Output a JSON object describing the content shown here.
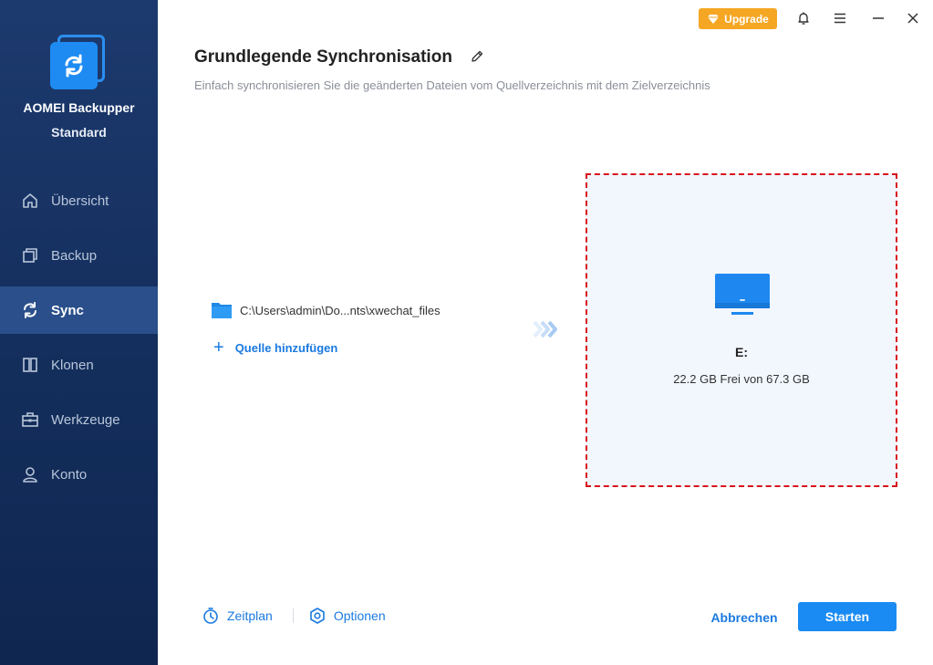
{
  "app": {
    "name": "AOMEI Backupper",
    "edition": "Standard",
    "logo_icon": "sync-logo-icon"
  },
  "sidebar": {
    "items": [
      {
        "label": "Übersicht",
        "icon": "home-icon",
        "active": false
      },
      {
        "label": "Backup",
        "icon": "backup-icon",
        "active": false
      },
      {
        "label": "Sync",
        "icon": "sync-icon",
        "active": true
      },
      {
        "label": "Klonen",
        "icon": "clone-icon",
        "active": false
      },
      {
        "label": "Werkzeuge",
        "icon": "toolbox-icon",
        "active": false
      },
      {
        "label": "Konto",
        "icon": "user-icon",
        "active": false
      }
    ]
  },
  "topbar": {
    "upgrade_label": "Upgrade",
    "icons": [
      "bell-icon",
      "menu-icon",
      "minimize-icon",
      "close-icon"
    ]
  },
  "header": {
    "title": "Grundlegende Synchronisation",
    "subtitle": "Einfach synchronisieren Sie die geänderten Dateien vom Quellverzeichnis mit dem Zielverzeichnis"
  },
  "source": {
    "path": "C:\\Users\\admin\\Do...nts\\xwechat_files",
    "add_label": "Quelle hinzufügen"
  },
  "destination": {
    "name": "E:",
    "free_space": "22.2 GB Frei von 67.3 GB"
  },
  "footer": {
    "schedule_label": "Zeitplan",
    "options_label": "Optionen",
    "cancel_label": "Abbrechen",
    "start_label": "Starten"
  },
  "colors": {
    "sidebar": "#1d3a6e",
    "accent": "#1a8bf2",
    "upgrade": "#f5a623",
    "dest_border": "#d8101e"
  }
}
